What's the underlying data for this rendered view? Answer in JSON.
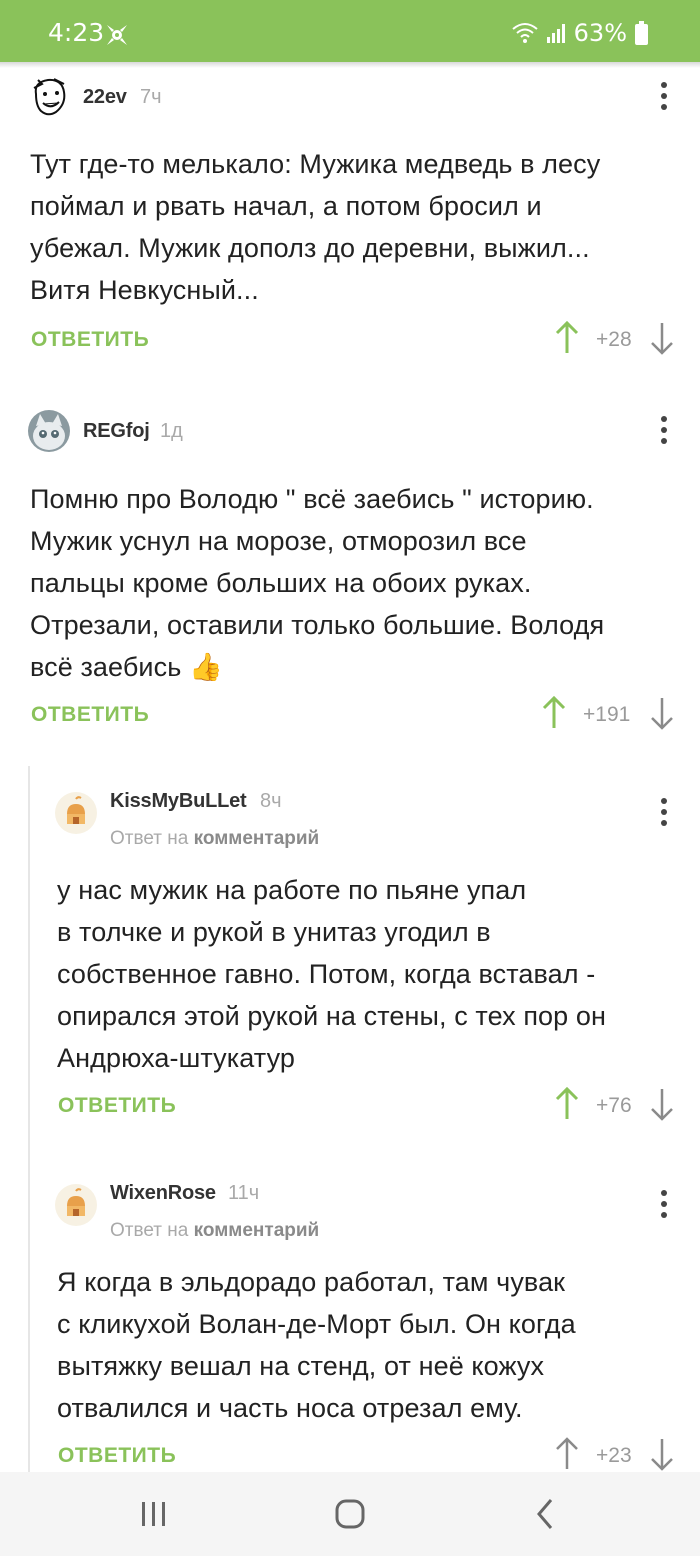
{
  "status": {
    "time": "4:23",
    "battery": "63%"
  },
  "comments": [
    {
      "author": "22ev",
      "ago": "7ч",
      "lines": [
        "Тут где-то мелькало: Мужика медведь в лесу",
        "поймал и рвать начал, а потом бросил и",
        "убежал. Мужик дополз до деревни, выжил...",
        "Витя Невкусный..."
      ],
      "reply": "ОТВЕТИТЬ",
      "score": "+28"
    },
    {
      "author": "REGfoj",
      "ago": "1д",
      "lines": [
        "Помню про Володю \" всё заебись \" историю.",
        "Мужик уснул на морозе, отморозил все",
        "пальцы кроме больших на обоих руках.",
        "Отрезали, оставили только большие. Володя",
        "всё заебись"
      ],
      "emoji": "👍",
      "reply": "ОТВЕТИТЬ",
      "score": "+191"
    },
    {
      "author": "KissMyBuLLet",
      "ago": "8ч",
      "reply_prefix": "Ответ на",
      "reply_target": "комментарий",
      "lines": [
        "у нас мужик на работе по пьяне упал",
        "в толчке и рукой в унитаз угодил в",
        "собственное гавно. Потом, когда вставал -",
        "опирался этой рукой на стены, с тех пор он",
        "Андрюха-штукатур"
      ],
      "reply": "ОТВЕТИТЬ",
      "score": "+76"
    },
    {
      "author": "WixenRose",
      "ago": "11ч",
      "reply_prefix": "Ответ на",
      "reply_target": "комментарий",
      "lines": [
        "Я когда в эльдорадо работал, там чувак",
        "с кликухой Волан-де-Морт был. Он когда",
        "вытяжку вешал на стенд, от неё кожух",
        "отвалился и часть носа отрезал ему."
      ],
      "reply": "ОТВЕТИТЬ",
      "score": "+23"
    }
  ],
  "colors": {
    "accent": "#8ac25a",
    "text": "#222222",
    "muted": "#a9a9a9"
  },
  "icons": [
    "vote-up-icon",
    "vote-down-icon",
    "more-icon",
    "recent-apps-icon",
    "home-icon",
    "back-icon"
  ]
}
